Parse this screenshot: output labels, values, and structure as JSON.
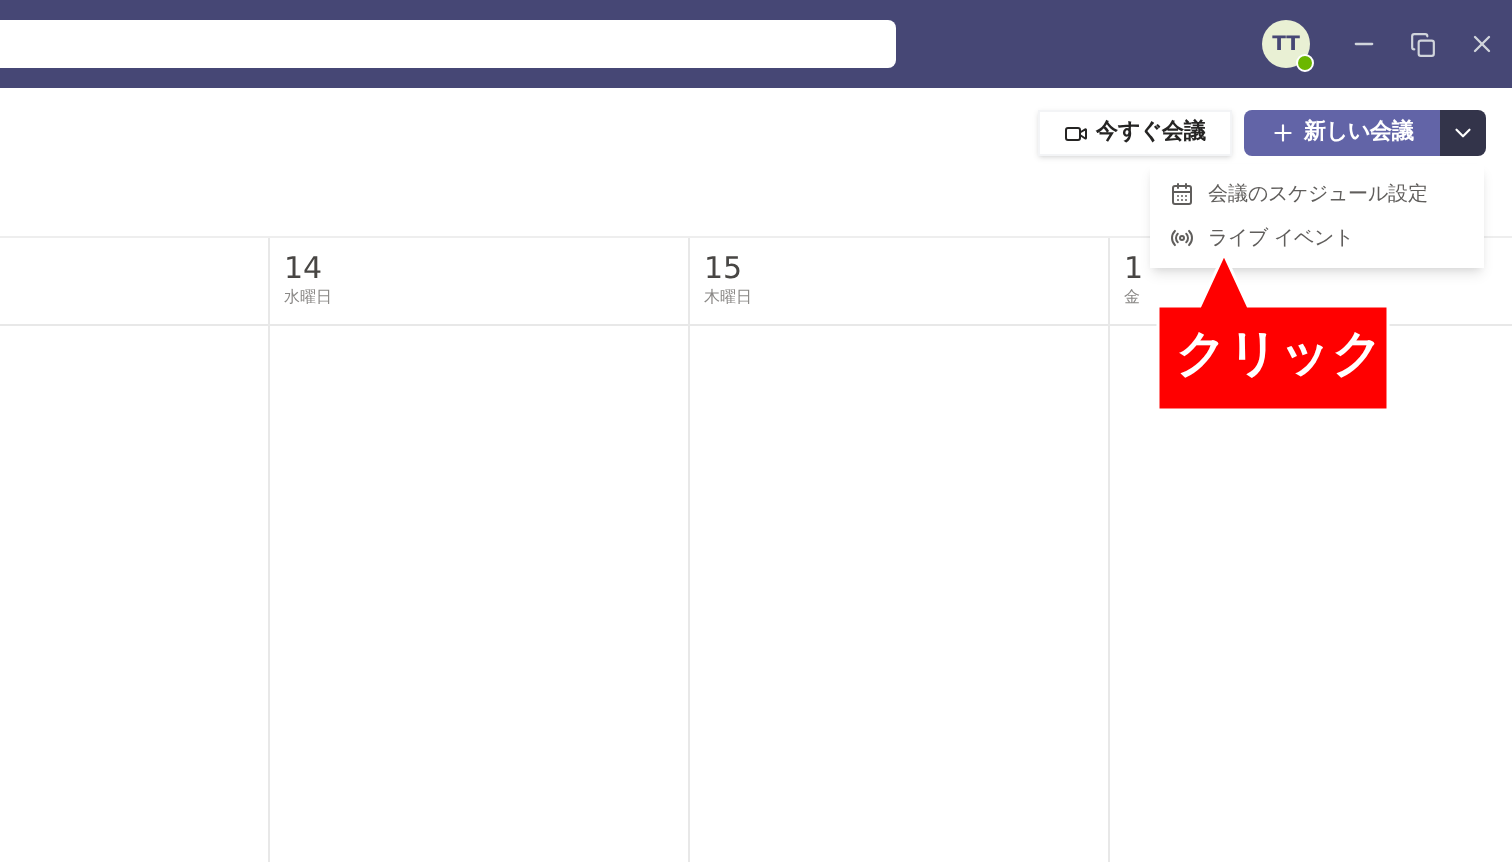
{
  "titlebar": {
    "avatar": "TT",
    "online": true
  },
  "toolbar": {
    "meet_now": "今すぐ会議",
    "new_meeting": "新しい会議",
    "new_meeting_menu_open": true
  },
  "menu": [
    {
      "kind": "calendar",
      "label": "会議のスケジュール設定"
    },
    {
      "kind": "live",
      "label": "ライブ イベント"
    }
  ],
  "days": [
    {
      "number": "14",
      "weekday": "水曜日"
    },
    {
      "number": "15",
      "weekday": "木曜日"
    },
    {
      "number": "1",
      "weekday": "金"
    }
  ],
  "callout": "クリック"
}
